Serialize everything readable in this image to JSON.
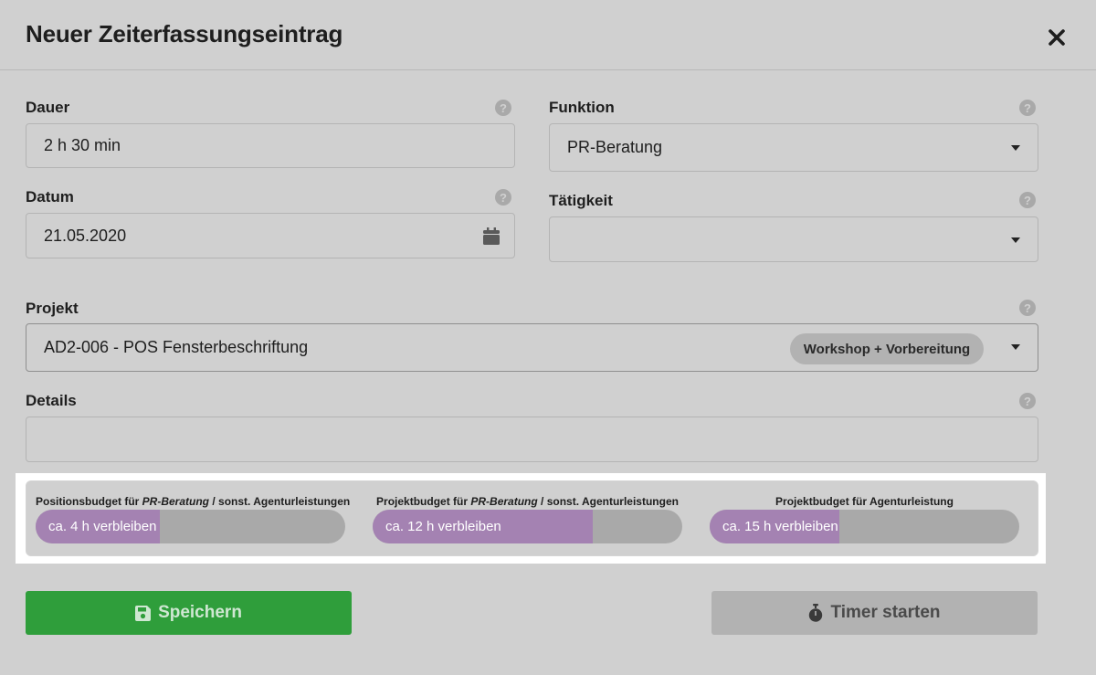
{
  "dialog": {
    "title": "Neuer Zeiterfassungseintrag",
    "close_icon": "close-icon"
  },
  "help_glyph": "?",
  "fields": {
    "dauer": {
      "label": "Dauer",
      "value": "2 h 30 min"
    },
    "datum": {
      "label": "Datum",
      "value": "21.05.2020",
      "icon": "calendar-icon"
    },
    "funktion": {
      "label": "Funktion",
      "value": "PR-Beratung"
    },
    "taetigkeit": {
      "label": "Tätigkeit",
      "value": ""
    },
    "projekt": {
      "label": "Projekt",
      "value": "AD2-006 - POS Fensterbeschriftung",
      "tag": "Workshop + Vorbereitung"
    },
    "details": {
      "label": "Details",
      "value": ""
    }
  },
  "budgets": [
    {
      "label_pre": "Positionsbudget für ",
      "label_em": "PR-Beratung",
      "label_post": " / sonst. Agenturleistungen",
      "text": "ca. 4 h verbleiben",
      "fill_fraction": 0.4
    },
    {
      "label_pre": "Projektbudget für ",
      "label_em": "PR-Beratung",
      "label_post": " / sonst. Agenturleistungen",
      "text": "ca. 12 h verbleiben",
      "fill_fraction": 0.71
    },
    {
      "label_pre": "Projektbudget für Agenturleistung",
      "label_em": "",
      "label_post": "",
      "text": "ca. 15 h verbleiben",
      "fill_fraction": 0.42
    }
  ],
  "buttons": {
    "save": {
      "label": "Speichern",
      "icon": "floppy-disk-icon"
    },
    "timer": {
      "label": "Timer starten",
      "icon": "stopwatch-icon"
    }
  },
  "colors": {
    "save_button": "#2f9e3b",
    "budget_fill": "#a482b2",
    "budget_track": "#a9a9a9"
  }
}
